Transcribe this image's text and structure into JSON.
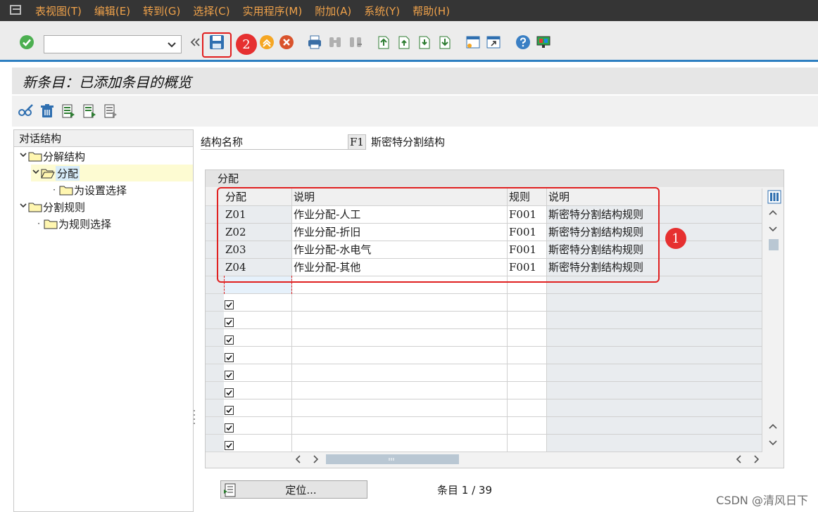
{
  "menu": [
    "表视图(T)",
    "编辑(E)",
    "转到(G)",
    "选择(C)",
    "实用程序(M)",
    "附加(A)",
    "系统(Y)",
    "帮助(H)"
  ],
  "toolbar": {
    "command_value": "",
    "icons": [
      "enter-icon",
      "back-icon",
      "save-icon",
      "exit-icon",
      "cancel-icon",
      "print-icon",
      "find-icon",
      "find-next-icon",
      "first-page-icon",
      "prev-page-icon",
      "next-page-icon",
      "last-page-icon",
      "new-session-icon",
      "shortcut-icon",
      "help-icon",
      "customize-layout-icon"
    ]
  },
  "annotations": {
    "badge_1": "1",
    "badge_2": "2"
  },
  "title": "新条目：已添加条目的概览",
  "app_toolbar_icons": [
    "glasses-edit-icon",
    "delete-icon",
    "select-all-icon",
    "select-block-icon",
    "deselect-all-icon"
  ],
  "left_panel": {
    "header": "对话结构",
    "tree": [
      {
        "label": "分解结构",
        "level": 0,
        "expanded": true
      },
      {
        "label": "分配",
        "level": 1,
        "expanded": true,
        "selected": true
      },
      {
        "label": "为设置选择",
        "level": 2
      },
      {
        "label": "分割规则",
        "level": 0,
        "expanded": true
      },
      {
        "label": "为规则选择",
        "level": 1
      }
    ]
  },
  "structure": {
    "label": "结构名称",
    "key": "F1",
    "name": "斯密特分割结构"
  },
  "table": {
    "caption": "分配",
    "columns": [
      "分配",
      "说明",
      "规则",
      "说明"
    ],
    "rows": [
      {
        "key": "Z01",
        "desc": "作业分配-人工",
        "rule": "F001",
        "rule_desc": "斯密特分割结构规则"
      },
      {
        "key": "Z02",
        "desc": "作业分配-折旧",
        "rule": "F001",
        "rule_desc": "斯密特分割结构规则"
      },
      {
        "key": "Z03",
        "desc": "作业分配-水电气",
        "rule": "F001",
        "rule_desc": "斯密特分割结构规则"
      },
      {
        "key": "Z04",
        "desc": "作业分配-其他",
        "rule": "F001",
        "rule_desc": "斯密特分割结构规则"
      }
    ],
    "empty_rows": 10
  },
  "footer": {
    "position_button": "定位...",
    "entry_info": "条目 1 / 39"
  },
  "watermark": "CSDN @清风日下",
  "colors": {
    "menubar": "#353535",
    "menu_text": "#f0a24a",
    "accent_blue": "#2d7fc1",
    "highlight_red": "#e02020"
  }
}
